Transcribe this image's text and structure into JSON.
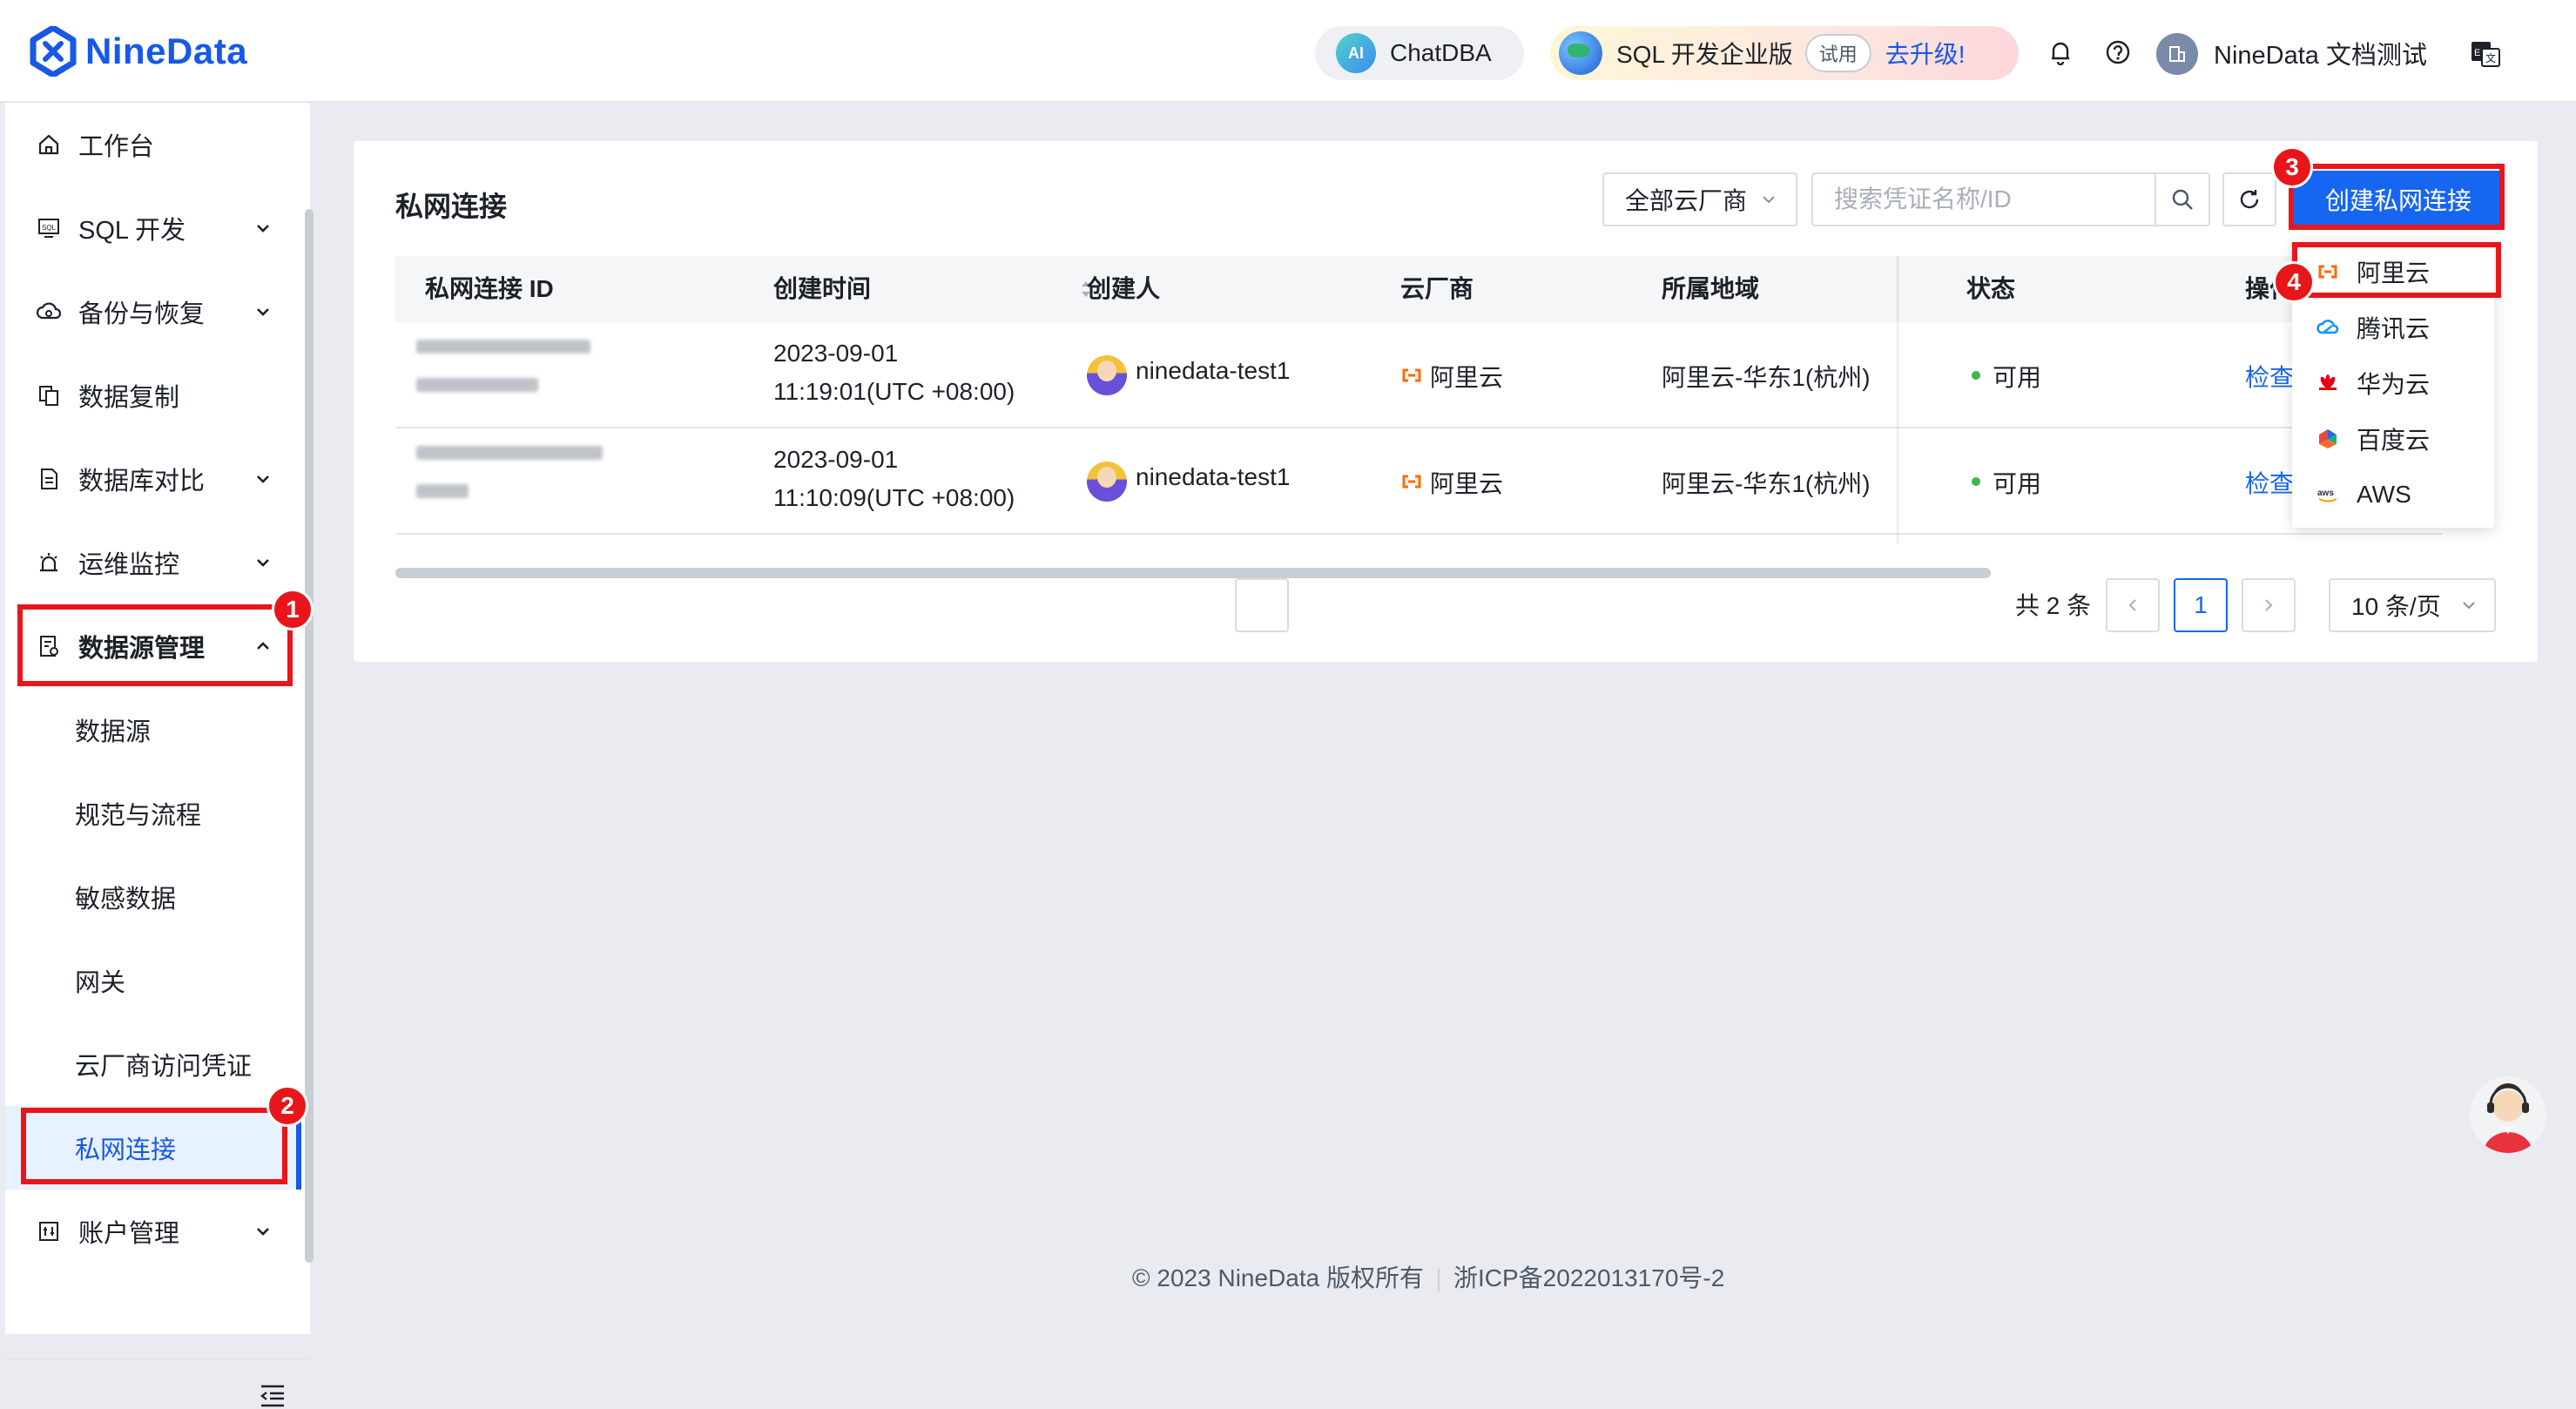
{
  "header": {
    "logo_text": "NineData",
    "chatdba_label": "ChatDBA",
    "ai_badge": "AI",
    "edition_label": "SQL 开发企业版",
    "trial_tag": "试用",
    "upgrade_label": "去升级!",
    "user_name": "NineData 文档测试",
    "language_icon": "translate-icon"
  },
  "sidebar": {
    "items": [
      {
        "label": "工作台",
        "icon": "home-icon"
      },
      {
        "label": "SQL 开发",
        "icon": "sql-icon"
      },
      {
        "label": "备份与恢复",
        "icon": "cloud-backup-icon"
      },
      {
        "label": "数据复制",
        "icon": "copy-icon"
      },
      {
        "label": "数据库对比",
        "icon": "compare-icon"
      },
      {
        "label": "运维监控",
        "icon": "alarm-icon"
      },
      {
        "label": "数据源管理",
        "icon": "datasource-icon"
      },
      {
        "label": "账户管理",
        "icon": "account-icon"
      }
    ],
    "sub_items": [
      "数据源",
      "规范与流程",
      "敏感数据",
      "网关",
      "云厂商访问凭证",
      "私网连接"
    ],
    "active_sub_item": "私网连接"
  },
  "page": {
    "title": "私网连接",
    "vendor_filter": "全部云厂商",
    "search_placeholder": "搜索凭证名称/ID",
    "create_button": "创建私网连接"
  },
  "table": {
    "columns": [
      "私网连接 ID",
      "创建时间",
      "创建人",
      "云厂商",
      "所属地域",
      "状态",
      "操作"
    ],
    "rows": [
      {
        "created_date": "2023-09-01",
        "created_time": "11:19:01(UTC +08:00)",
        "creator": "ninedata-test1",
        "vendor": "阿里云",
        "region": "阿里云-华东1(杭州)",
        "status": "可用",
        "action": "检查"
      },
      {
        "created_date": "2023-09-01",
        "created_time": "11:10:09(UTC +08:00)",
        "creator": "ninedata-test1",
        "vendor": "阿里云",
        "region": "阿里云-华东1(杭州)",
        "status": "可用",
        "action": "检查"
      }
    ]
  },
  "pagination": {
    "total": "共 2 条",
    "current_page": "1",
    "page_size": "10 条/页"
  },
  "dropdown": {
    "items": [
      {
        "label": "阿里云",
        "icon": "aliyun-icon"
      },
      {
        "label": "腾讯云",
        "icon": "tencent-cloud-icon"
      },
      {
        "label": "华为云",
        "icon": "huawei-cloud-icon"
      },
      {
        "label": "百度云",
        "icon": "baidu-cloud-icon"
      },
      {
        "label": "AWS",
        "icon": "aws-icon"
      }
    ]
  },
  "annotations": {
    "step1": "1",
    "step2": "2",
    "step3": "3",
    "step4": "4"
  },
  "footer": {
    "copyright": "© 2023 NineData 版权所有",
    "icp": "浙ICP备2022013170号-2"
  },
  "colors": {
    "primary": "#1766f2",
    "annotation_red": "#e8161b",
    "status_green": "#3cb64a",
    "aliyun_orange": "#ff6a00"
  }
}
